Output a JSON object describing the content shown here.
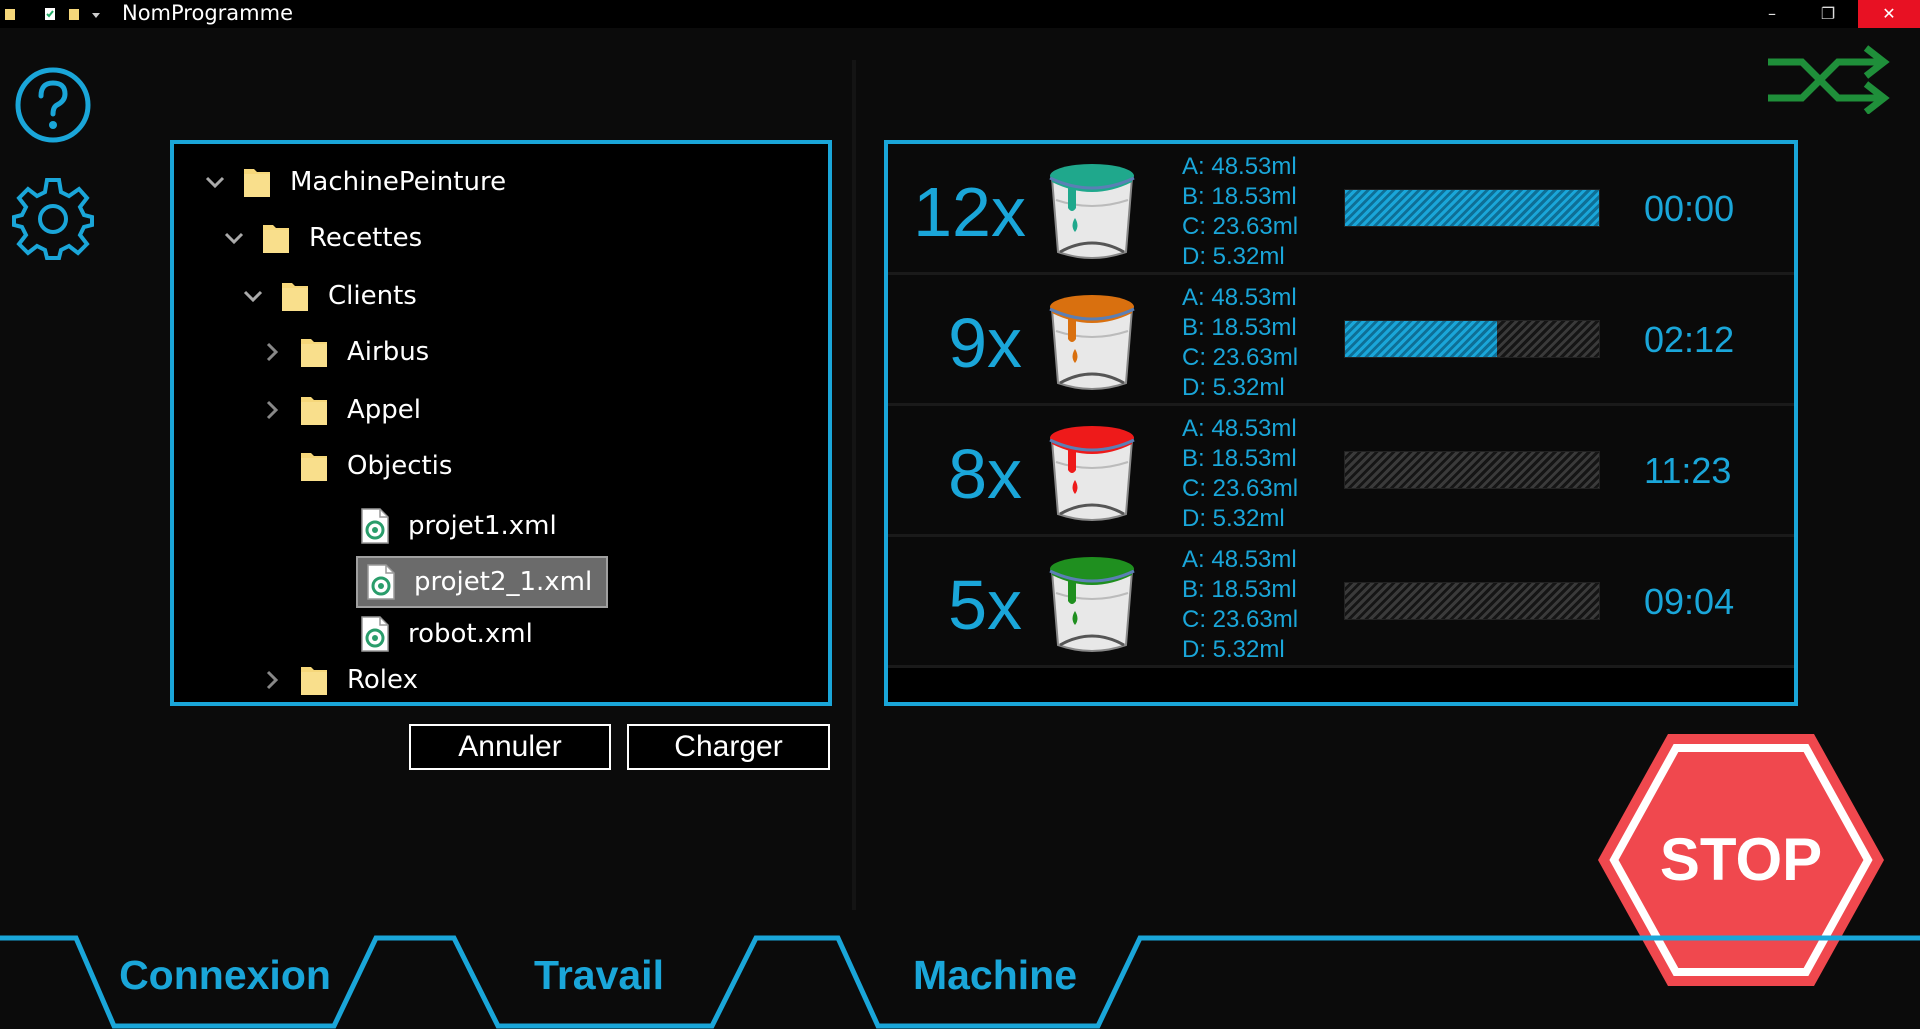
{
  "window": {
    "title": "NomProgramme",
    "minimize": "–",
    "restore": "❐",
    "close": "✕"
  },
  "tree": [
    {
      "label": "MachinePeinture",
      "type": "folder",
      "expanded": true,
      "depth": 0
    },
    {
      "label": "Recettes",
      "type": "folder",
      "expanded": true,
      "depth": 1
    },
    {
      "label": "Clients",
      "type": "folder",
      "expanded": true,
      "depth": 2
    },
    {
      "label": "Airbus",
      "type": "folder",
      "expanded": false,
      "depth": 3
    },
    {
      "label": "Appel",
      "type": "folder",
      "expanded": false,
      "depth": 3
    },
    {
      "label": "Objectis",
      "type": "folder",
      "expanded": true,
      "depth": 3
    },
    {
      "label": "projet1.xml",
      "type": "file",
      "depth": 4
    },
    {
      "label": "projet2_1.xml",
      "type": "file",
      "depth": 4,
      "selected": true
    },
    {
      "label": "robot.xml",
      "type": "file",
      "depth": 4
    },
    {
      "label": "Rolex",
      "type": "folder",
      "expanded": false,
      "depth": 3
    }
  ],
  "buttons": {
    "cancel": "Annuler",
    "load": "Charger"
  },
  "jobs": [
    {
      "count": "12x",
      "paint_color": "#1fa88c",
      "volumes": [
        "A: 48.53ml",
        "B: 18.53ml",
        "C: 23.63ml",
        "D: 5.32ml"
      ],
      "progress": 1.0,
      "time": "00:00"
    },
    {
      "count": "9x",
      "paint_color": "#d9700f",
      "volumes": [
        "A: 48.53ml",
        "B: 18.53ml",
        "C: 23.63ml",
        "D: 5.32ml"
      ],
      "progress": 0.6,
      "time": "02:12"
    },
    {
      "count": "8x",
      "paint_color": "#ee1a1a",
      "volumes": [
        "A: 48.53ml",
        "B: 18.53ml",
        "C: 23.63ml",
        "D: 5.32ml"
      ],
      "progress": 0.0,
      "time": "11:23"
    },
    {
      "count": "5x",
      "paint_color": "#1f8f1f",
      "volumes": [
        "A: 48.53ml",
        "B: 18.53ml",
        "C: 23.63ml",
        "D: 5.32ml"
      ],
      "progress": 0.0,
      "time": "09:04"
    }
  ],
  "stop_label": "STOP",
  "tabs": [
    {
      "label": "Connexion",
      "active": false
    },
    {
      "label": "Travail",
      "active": true
    },
    {
      "label": "Machine",
      "active": false
    }
  ],
  "colors": {
    "accent": "#1aa6d9",
    "stop": "#f0484e",
    "shuffle": "#1f8f3a",
    "folder": "#f6d77a"
  },
  "icons": [
    "help-icon",
    "gear-icon",
    "shuffle-icon",
    "folder-icon",
    "xml-file-icon",
    "paint-bucket-icon",
    "stop-sign-icon",
    "chevron-icon"
  ]
}
